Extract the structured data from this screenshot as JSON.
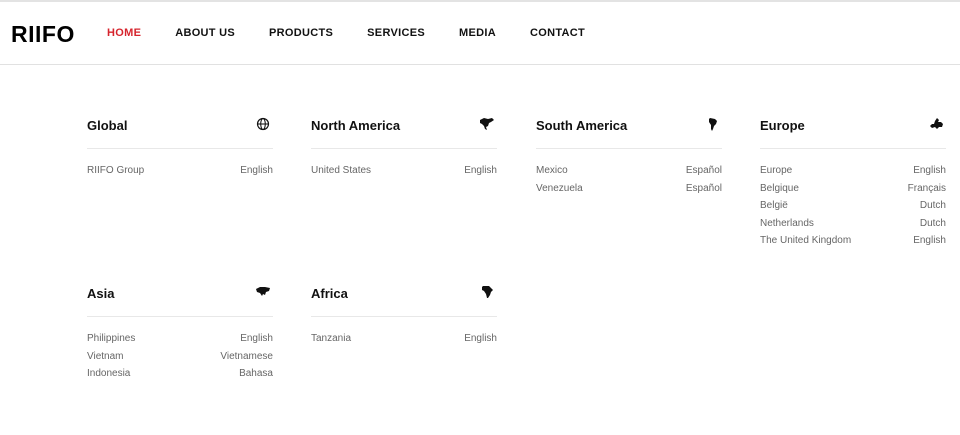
{
  "header": {
    "logo": "RIIFO",
    "nav": [
      {
        "label": "HOME",
        "active": true
      },
      {
        "label": "ABOUT US",
        "active": false
      },
      {
        "label": "PRODUCTS",
        "active": false
      },
      {
        "label": "SERVICES",
        "active": false
      },
      {
        "label": "MEDIA",
        "active": false
      },
      {
        "label": "CONTACT",
        "active": false
      }
    ],
    "accent_color": "#d6242d"
  },
  "regions": [
    {
      "title": "Global",
      "icon": "globe-icon",
      "sites": [
        {
          "country": "RIIFO Group",
          "language": "English"
        }
      ]
    },
    {
      "title": "North America",
      "icon": "north-america-map-icon",
      "sites": [
        {
          "country": "United States",
          "language": "English"
        }
      ]
    },
    {
      "title": "South America",
      "icon": "south-america-map-icon",
      "sites": [
        {
          "country": "Mexico",
          "language": "Español"
        },
        {
          "country": "Venezuela",
          "language": "Español"
        }
      ]
    },
    {
      "title": "Europe",
      "icon": "europe-map-icon",
      "sites": [
        {
          "country": "Europe",
          "language": "English"
        },
        {
          "country": "Belgique",
          "language": "Français"
        },
        {
          "country": "België",
          "language": "Dutch"
        },
        {
          "country": "Netherlands",
          "language": "Dutch"
        },
        {
          "country": "The United Kingdom",
          "language": "English"
        }
      ]
    },
    {
      "title": "Asia",
      "icon": "asia-map-icon",
      "sites": [
        {
          "country": "Philippines",
          "language": "English"
        },
        {
          "country": "Vietnam",
          "language": "Vietnamese"
        },
        {
          "country": "Indonesia",
          "language": "Bahasa"
        }
      ]
    },
    {
      "title": "Africa",
      "icon": "africa-map-icon",
      "sites": [
        {
          "country": "Tanzania",
          "language": "English"
        }
      ]
    }
  ]
}
